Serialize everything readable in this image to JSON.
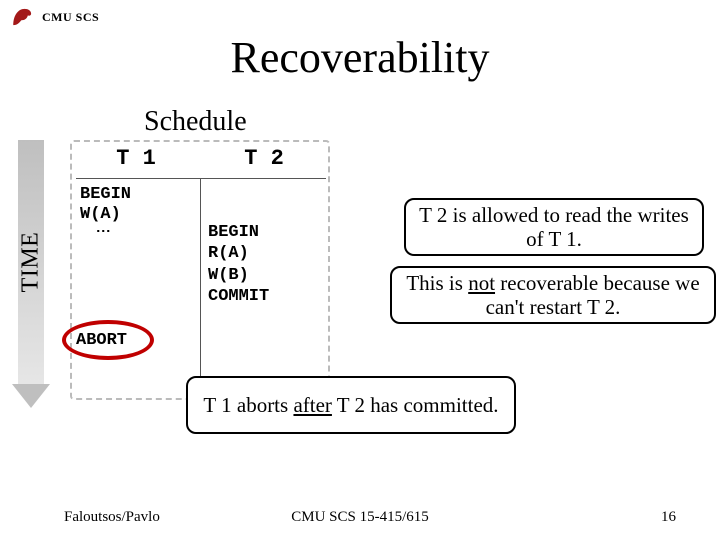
{
  "header": {
    "org": "CMU SCS"
  },
  "title": "Recoverability",
  "schedule_label": "Schedule",
  "time_label": "TIME",
  "columns": {
    "t1": "T 1",
    "t2": "T 2"
  },
  "t1": {
    "begin": "BEGIN",
    "wa": "W(A)",
    "dots": "⋮",
    "abort": "ABORT"
  },
  "t2": {
    "block": "BEGIN\nR(A)\nW(B)\nCOMMIT"
  },
  "callouts": {
    "c1": "T 2 is allowed to read the writes of T 1.",
    "c2_a": "This is ",
    "c2_u": "not",
    "c2_b": " recoverable because we can't restart T 2.",
    "c3_a": "T 1 aborts ",
    "c3_u": "after",
    "c3_b": " T 2 has committed."
  },
  "footer": {
    "left": "Faloutsos/Pavlo",
    "center": "CMU SCS 15-415/615",
    "right": "16"
  }
}
